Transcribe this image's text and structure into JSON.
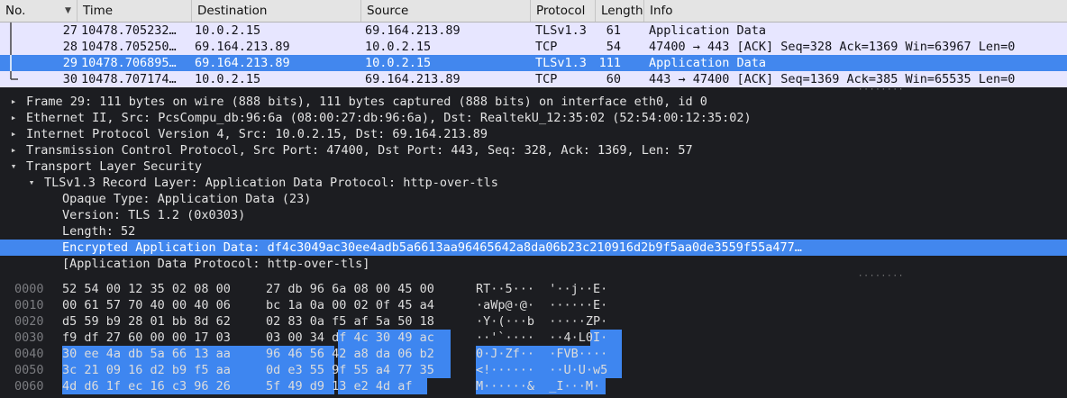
{
  "columns": [
    "No.",
    "Time",
    "Destination",
    "Source",
    "Protocol",
    "Length",
    "Info"
  ],
  "packets": [
    {
      "no": "27",
      "time": "10478.705232…",
      "dst": "10.0.2.15",
      "src": "69.164.213.89",
      "proto": "TLSv1.3",
      "len": "61",
      "info": "Application Data"
    },
    {
      "no": "28",
      "time": "10478.705250…",
      "dst": "69.164.213.89",
      "src": "10.0.2.15",
      "proto": "TCP",
      "len": "54",
      "info": "47400 → 443 [ACK] Seq=328 Ack=1369 Win=63967 Len=0"
    },
    {
      "no": "29",
      "time": "10478.706895…",
      "dst": "69.164.213.89",
      "src": "10.0.2.15",
      "proto": "TLSv1.3",
      "len": "111",
      "info": "Application Data"
    },
    {
      "no": "30",
      "time": "10478.707174…",
      "dst": "10.0.2.15",
      "src": "69.164.213.89",
      "proto": "TCP",
      "len": "60",
      "info": "443 → 47400 [ACK] Seq=1369 Ack=385 Win=65535 Len=0"
    }
  ],
  "details": [
    {
      "text": "Frame 29: 111 bytes on wire (888 bits), 111 bytes captured (888 bits) on interface eth0, id 0"
    },
    {
      "text": "Ethernet II, Src: PcsCompu_db:96:6a (08:00:27:db:96:6a), Dst: RealtekU_12:35:02 (52:54:00:12:35:02)"
    },
    {
      "text": "Internet Protocol Version 4, Src: 10.0.2.15, Dst: 69.164.213.89"
    },
    {
      "text": "Transmission Control Protocol, Src Port: 47400, Dst Port: 443, Seq: 328, Ack: 1369, Len: 57"
    },
    {
      "text": "Transport Layer Security"
    },
    {
      "text": "TLSv1.3 Record Layer: Application Data Protocol: http-over-tls"
    },
    {
      "text": "Opaque Type: Application Data (23)"
    },
    {
      "text": "Version: TLS 1.2 (0x0303)"
    },
    {
      "text": "Length: 52"
    },
    {
      "text": "Encrypted Application Data: df4c3049ac30ee4adb5a6613aa96465642a8da06b23c210916d2b9f5aa0de3559f55a477…"
    },
    {
      "text": "[Application Data Protocol: http-over-tls]"
    }
  ],
  "bytes": [
    {
      "offset": "0000",
      "hex1": "52 54 00 12 35 02 08 00",
      "hex2": "27 db 96 6a 08 00 45 00",
      "ascii": "RT··5···  '··j··E·"
    },
    {
      "offset": "0010",
      "hex1": "00 61 57 70 40 00 40 06",
      "hex2": "bc 1a 0a 00 02 0f 45 a4",
      "ascii": "·aWp@·@·  ······E·"
    },
    {
      "offset": "0020",
      "hex1": "d5 59 b9 28 01 bb 8d 62",
      "hex2": "02 83 0a f5 af 5a 50 18",
      "ascii": "·Y·(···b  ·····ZP·"
    },
    {
      "offset": "0030",
      "hex1": "f9 df 27 60 00 00 17 03",
      "hex2": "03 00 34 df 4c 30 49 ac",
      "ascii": "··'`····  ··4·L0I·"
    },
    {
      "offset": "0040",
      "hex1": "30 ee 4a db 5a 66 13 aa",
      "hex2": "96 46 56 42 a8 da 06 b2",
      "ascii": "0·J·Zf··  ·FVB····"
    },
    {
      "offset": "0050",
      "hex1": "3c 21 09 16 d2 b9 f5 aa",
      "hex2": "0d e3 55 9f 55 a4 77 35",
      "ascii": "<!······  ··U·U·w5"
    },
    {
      "offset": "0060",
      "hex1": "4d d6 1f ec 16 c3 96 26",
      "hex2": "5f 49 d9 13 e2 4d af",
      "ascii": "M······&  _I···M·"
    }
  ],
  "colors": {
    "selected": "#4287ee",
    "tls_row": "#e7e6ff",
    "background": "#1c1d21"
  }
}
